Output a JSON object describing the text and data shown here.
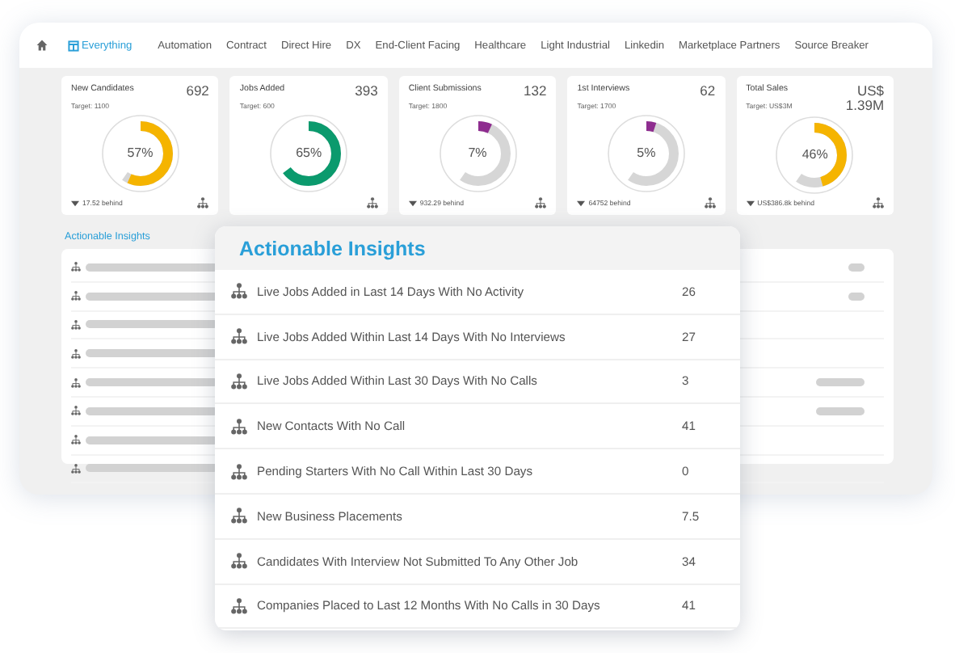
{
  "nav": {
    "tabs": [
      {
        "label": "Everything",
        "selected": true
      },
      {
        "label": "Automation",
        "selected": false
      },
      {
        "label": "Contract",
        "selected": false
      },
      {
        "label": "Direct Hire",
        "selected": false
      },
      {
        "label": "DX",
        "selected": false
      },
      {
        "label": "End-Client Facing",
        "selected": false
      },
      {
        "label": "Healthcare",
        "selected": false
      },
      {
        "label": "Light Industrial",
        "selected": false
      },
      {
        "label": "Linkedin",
        "selected": false
      },
      {
        "label": "Marketplace Partners",
        "selected": false
      },
      {
        "label": "Source Breaker",
        "selected": false
      }
    ]
  },
  "kpis": [
    {
      "title": "New Candidates",
      "value": "692",
      "target": "Target: 1100",
      "percent": "57%",
      "level": 0.57,
      "color": "#f5b400",
      "behind": "17.52 behind"
    },
    {
      "title": "Jobs Added",
      "value": "393",
      "target": "Target: 600",
      "percent": "65%",
      "level": 0.65,
      "color": "#0b9a6d"
    },
    {
      "title": "Client Submissions",
      "value": "132",
      "target": "Target: 1800",
      "percent": "7%",
      "level": 0.07,
      "color": "#8e2d8f",
      "behind": "932.29 behind"
    },
    {
      "title": "1st Interviews",
      "value": "62",
      "target": "Target: 1700",
      "percent": "5%",
      "level": 0.05,
      "color": "#8e2d8f",
      "behind": "64752 behind"
    },
    {
      "title": "Total Sales",
      "value": "US$ 1.39M",
      "target": "Target: US$3M",
      "percent": "46%",
      "level": 0.46,
      "color": "#f5b400",
      "behind": "US$386.8k behind"
    }
  ],
  "section_title": "Actionable Insights",
  "popup": {
    "title": "Actionable Insights",
    "rows": [
      {
        "label": "Live Jobs Added in Last 14 Days With No Activity",
        "count": "26"
      },
      {
        "label": "Live Jobs Added Within Last 14 Days With No Interviews",
        "count": "27"
      },
      {
        "label": "Live Jobs Added Within Last 30 Days With No Calls",
        "count": "3"
      },
      {
        "label": "New Contacts With No Call",
        "count": "41"
      },
      {
        "label": "Pending Starters With No Call Within Last 30 Days",
        "count": "0"
      },
      {
        "label": "New Business Placements",
        "count": "7.5"
      },
      {
        "label": "Candidates With Interview Not Submitted To Any Other Job",
        "count": "34"
      },
      {
        "label": "Companies Placed to Last 12 Months With No Calls in 30 Days",
        "count": "41"
      }
    ]
  }
}
